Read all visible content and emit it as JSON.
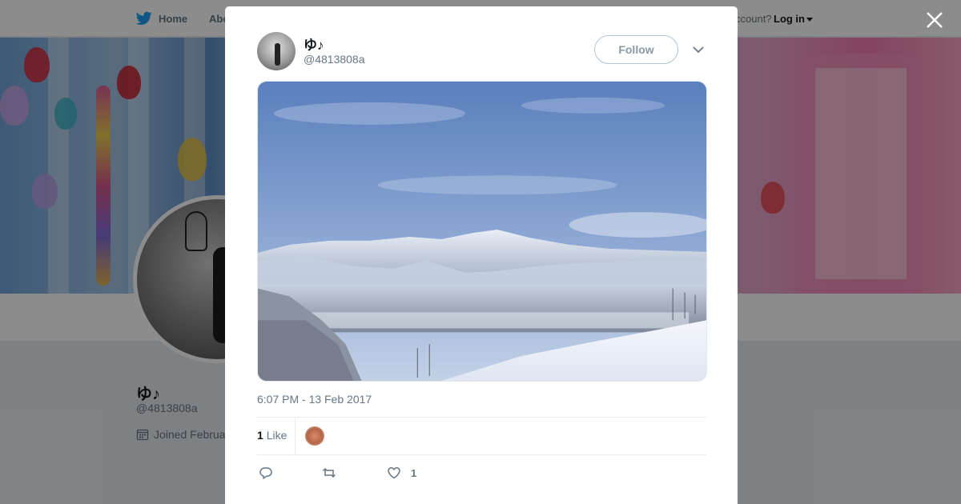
{
  "nav": {
    "home_label": "Home",
    "about_label": "Abo",
    "account_text": "ccount?",
    "login_label": "Log in"
  },
  "profile": {
    "name": "ゆ♪",
    "handle": "@4813808a",
    "joined_text": "Joined Februa"
  },
  "tweet": {
    "author_name": "ゆ♪",
    "author_handle": "@4813808a",
    "follow_label": "Follow",
    "timestamp": "6:07 PM - 13 Feb 2017",
    "likes_count": "1",
    "likes_label": "Like",
    "like_action_count": "1"
  },
  "icons": {
    "close": "close-icon",
    "reply": "reply-icon",
    "retweet": "retweet-icon",
    "like": "heart-icon",
    "more": "chevron-down-icon",
    "logo": "twitter-bird-icon"
  },
  "colors": {
    "brand_blue": "#1da1f2",
    "secondary_text": "#657786",
    "follow_border": "#b3c3d1"
  }
}
